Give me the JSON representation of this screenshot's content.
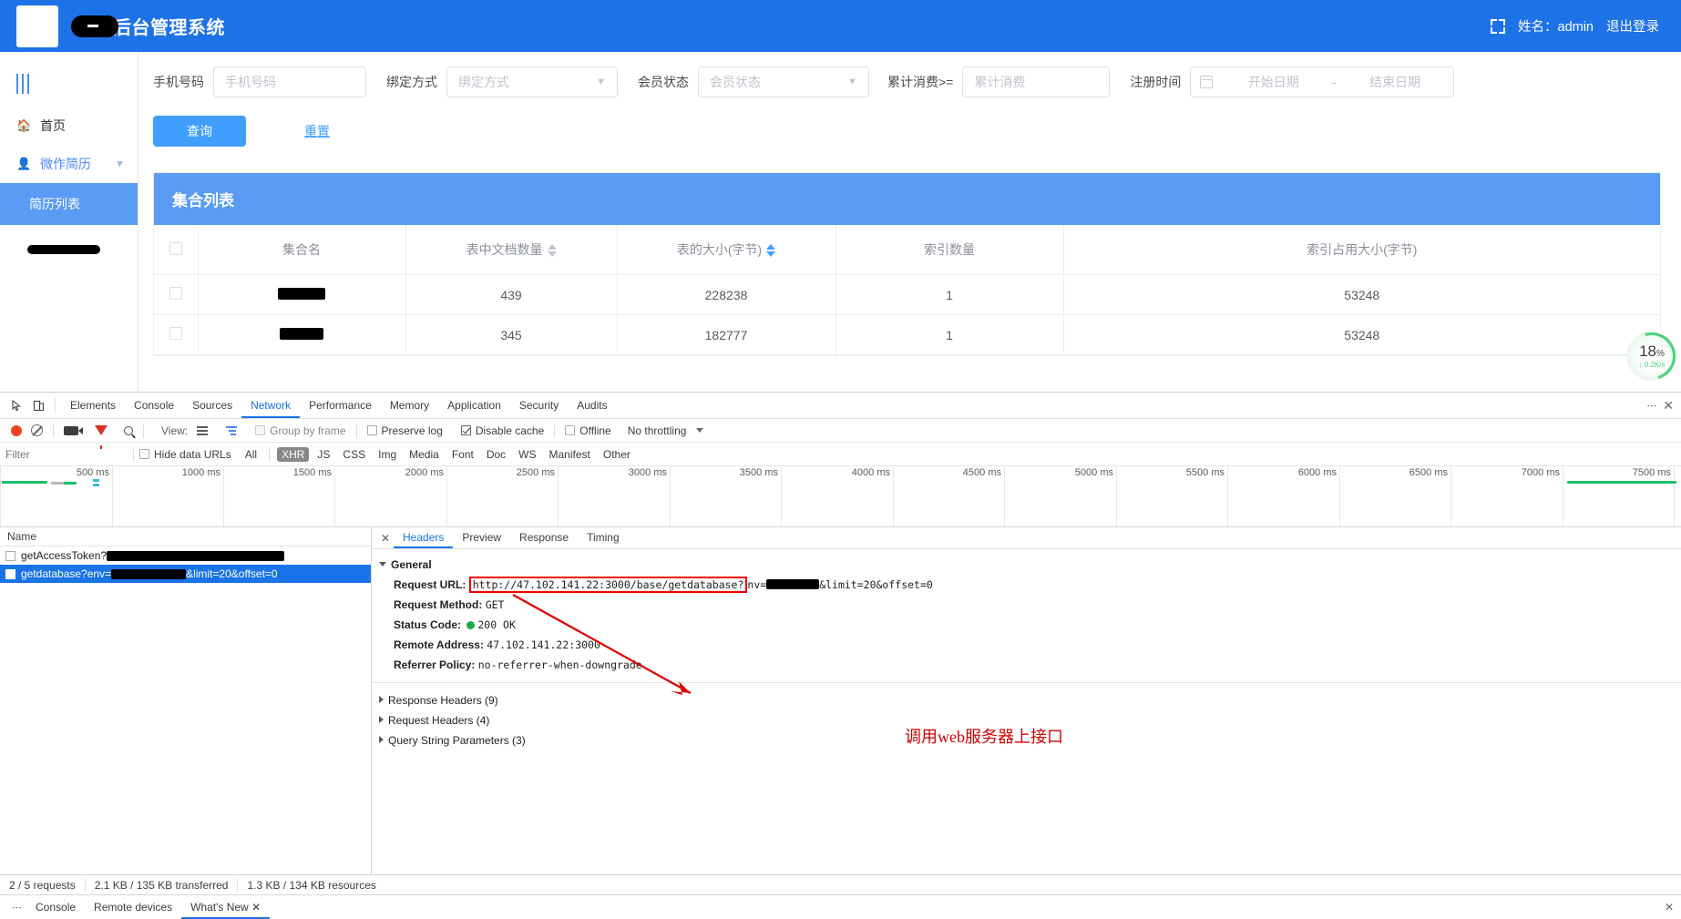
{
  "app": {
    "header": {
      "brand_title": "后台管理系统",
      "fullscreen_icon": "fullscreen-icon",
      "user_label": "姓名：admin",
      "logout_label": "退出登录"
    },
    "sidebar": {
      "collapse_icon": "hamburger-icon",
      "items": [
        {
          "label": "首页",
          "icon": "home-icon"
        },
        {
          "label": "微作简历",
          "icon": "user-icon",
          "chevron": "chevron-up-icon"
        }
      ],
      "sub_items": [
        {
          "label": "简历列表",
          "active": true
        }
      ]
    },
    "filters": {
      "phone_label": "手机号码",
      "phone_placeholder": "手机号码",
      "bind_label": "绑定方式",
      "bind_placeholder": "绑定方式",
      "status_label": "会员状态",
      "status_placeholder": "会员状态",
      "cost_label": "累计消费>=",
      "cost_placeholder": "累计消费",
      "time_label": "注册时间",
      "date_start_placeholder": "开始日期",
      "date_sep": "-",
      "date_end_placeholder": "结束日期",
      "calendar_icon": "calendar-icon",
      "query_button": "查询",
      "reset_button": "重置"
    },
    "panel": {
      "title": "集合列表",
      "columns": [
        {
          "label": "",
          "type": "checkbox"
        },
        {
          "label": "集合名",
          "sortable": false
        },
        {
          "label": "表中文档数量",
          "sortable": true,
          "sort_active": false
        },
        {
          "label": "表的大小(字节)",
          "sortable": true,
          "sort_active": true
        },
        {
          "label": "索引数量",
          "sortable": false
        },
        {
          "label": "索引占用大小(字节)",
          "sortable": false
        }
      ],
      "rows": [
        {
          "name": "[redacted]",
          "doc_count": "439",
          "table_size": "228238",
          "index_count": "1",
          "index_size": "53248"
        },
        {
          "name": "[redacted]",
          "doc_count": "345",
          "table_size": "182777",
          "index_count": "1",
          "index_size": "53248"
        }
      ]
    },
    "speed_badge": {
      "percent": "18",
      "percent_unit": "%",
      "rate": "↓ 0.2K/s",
      "color": "#4cd07d"
    }
  },
  "devtools": {
    "panel_tabs": [
      "Elements",
      "Console",
      "Sources",
      "Network",
      "Performance",
      "Memory",
      "Application",
      "Security",
      "Audits"
    ],
    "active_panel_tab": "Network",
    "inspect_icon": "inspect-element-icon",
    "device_icon": "device-toolbar-icon",
    "more_icon": "more-options-icon",
    "close_icon": "close-devtools-icon",
    "toolbar": {
      "record_icon": "record-icon",
      "clear_icon": "clear-icon",
      "camera_icon": "capture-screenshots-icon",
      "filter_icon": "filter-icon",
      "search_icon": "search-icon",
      "view_label": "View:",
      "list_view_icon": "list-view-icon",
      "waterfall_view_icon": "waterfall-view-icon",
      "group_by_frame": {
        "label": "Group by frame",
        "checked": false,
        "disabled": true
      },
      "preserve_log": {
        "label": "Preserve log",
        "checked": false
      },
      "disable_cache": {
        "label": "Disable cache",
        "checked": true
      },
      "offline": {
        "label": "Offline",
        "checked": false
      },
      "throttling": "No throttling",
      "throttling_caret": "chevron-down-icon"
    },
    "filterbar": {
      "filter_placeholder": "Filter",
      "hide_data_urls": {
        "label": "Hide data URLs",
        "checked": false
      },
      "types": [
        "All",
        "XHR",
        "JS",
        "CSS",
        "Img",
        "Media",
        "Font",
        "Doc",
        "WS",
        "Manifest",
        "Other"
      ],
      "selected_type": "XHR"
    },
    "timeline": {
      "ticks": [
        "500 ms",
        "1000 ms",
        "1500 ms",
        "2000 ms",
        "2500 ms",
        "3000 ms",
        "3500 ms",
        "4000 ms",
        "4500 ms",
        "5000 ms",
        "5500 ms",
        "6000 ms",
        "6500 ms",
        "7000 ms",
        "7500 ms"
      ]
    },
    "requests": {
      "header": "Name",
      "rows": [
        {
          "name": "getAccessToken?",
          "selected": false,
          "redacted": true
        },
        {
          "name": "getdatabase?env=",
          "suffix": "&limit=20&offset=0",
          "selected": true,
          "redacted": true
        }
      ]
    },
    "detail": {
      "tabs": [
        "Headers",
        "Preview",
        "Response",
        "Timing"
      ],
      "active_tab": "Headers",
      "general_title": "General",
      "fields": [
        {
          "key": "Request URL:",
          "value_highlighted": "http://47.102.141.22:3000/base/getdatabase?",
          "value_after_redact": "&limit=20&offset=0",
          "value_mid": "nv="
        },
        {
          "key": "Request Method:",
          "value": "GET"
        },
        {
          "key": "Status Code:",
          "value": "200  OK",
          "status_dot": "#1aaa4b"
        },
        {
          "key": "Remote Address:",
          "value": "47.102.141.22:3000"
        },
        {
          "key": "Referrer Policy:",
          "value": "no-referrer-when-downgrade"
        }
      ],
      "sections": [
        "Response Headers (9)",
        "Request Headers (4)",
        "Query String Parameters (3)"
      ],
      "annotation": "调用web服务器上接口"
    },
    "status": [
      "2 / 5 requests",
      "2.1 KB / 135 KB transferred",
      "1.3 KB / 134 KB resources"
    ],
    "drawer": {
      "tabs": [
        "Console",
        "Remote devices",
        "What's New"
      ],
      "active_tab": "What's New",
      "close_tab_icon": "close-icon",
      "close_drawer_icon": "close-icon",
      "menu_icon": "kebab-menu-icon"
    }
  }
}
